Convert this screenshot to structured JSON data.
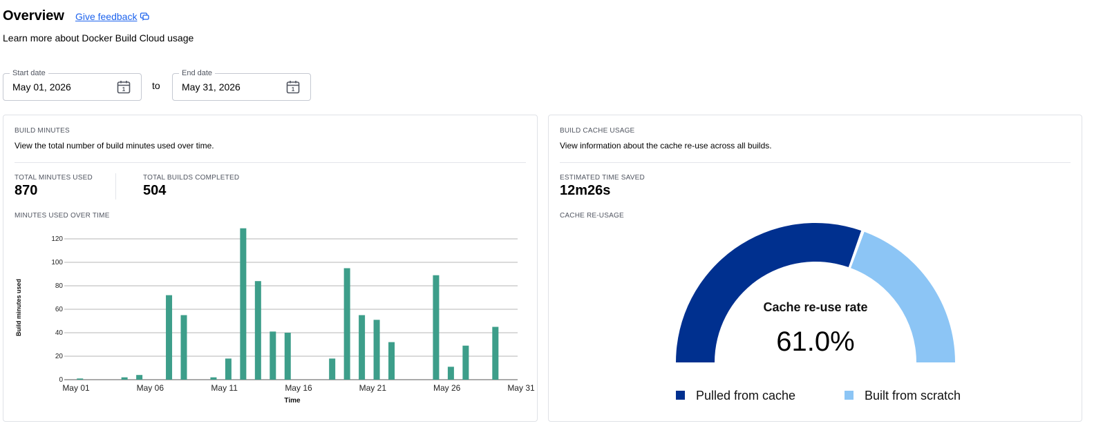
{
  "header": {
    "title": "Overview",
    "feedback_label": "Give feedback",
    "subtitle": "Learn more about Docker Build Cloud usage"
  },
  "date_range": {
    "start_label": "Start date",
    "start_value": "May 01, 2026",
    "to_label": "to",
    "end_label": "End date",
    "end_value": "May 31, 2026",
    "calendar_icon_day": "1"
  },
  "build_minutes": {
    "eyebrow": "BUILD MINUTES",
    "description": "View the total number of build minutes used over time.",
    "total_minutes_label": "TOTAL MINUTES USED",
    "total_minutes_value": "870",
    "total_builds_label": "TOTAL BUILDS COMPLETED",
    "total_builds_value": "504",
    "chart_label": "MINUTES USED OVER TIME"
  },
  "build_cache": {
    "eyebrow": "BUILD CACHE USAGE",
    "description": "View information about the cache re-use across all builds.",
    "time_saved_label": "ESTIMATED TIME SAVED",
    "time_saved_value": "12m26s",
    "reuse_label": "CACHE RE-USAGE",
    "gauge_title": "Cache re-use rate",
    "gauge_value": "61.0%"
  },
  "colors": {
    "accent_link": "#1d63ed",
    "bar": "#3d9e8a",
    "pulled": "#00308f",
    "scratch": "#8cc5f5"
  },
  "icons": {
    "feedback": "chat-bubble-icon",
    "calendar": "calendar-icon"
  },
  "chart_data": [
    {
      "type": "bar",
      "xlabel": "Time",
      "ylabel": "Build minutes used",
      "ylim": [
        0,
        130
      ],
      "yticks": [
        0,
        20,
        40,
        60,
        80,
        100,
        120
      ],
      "xtick_labels": [
        "May 01",
        "May 06",
        "May 11",
        "May 16",
        "May 21",
        "May 26",
        "May 31"
      ],
      "grid": true,
      "x": [
        1,
        2,
        3,
        4,
        5,
        6,
        7,
        8,
        9,
        10,
        11,
        12,
        13,
        14,
        15,
        16,
        17,
        18,
        19,
        20,
        21,
        22,
        23,
        24,
        25,
        26,
        27,
        28,
        29,
        30
      ],
      "values": [
        1,
        0,
        0,
        2,
        4,
        0,
        72,
        55,
        0,
        2,
        18,
        129,
        84,
        41,
        40,
        0,
        0,
        18,
        95,
        55,
        51,
        32,
        0,
        0,
        89,
        11,
        29,
        0,
        45,
        0
      ]
    },
    {
      "type": "pie",
      "variant": "semicircle-gauge",
      "labels": [
        "Pulled from cache",
        "Built from scratch"
      ],
      "values": [
        61.0,
        39.0
      ]
    }
  ]
}
